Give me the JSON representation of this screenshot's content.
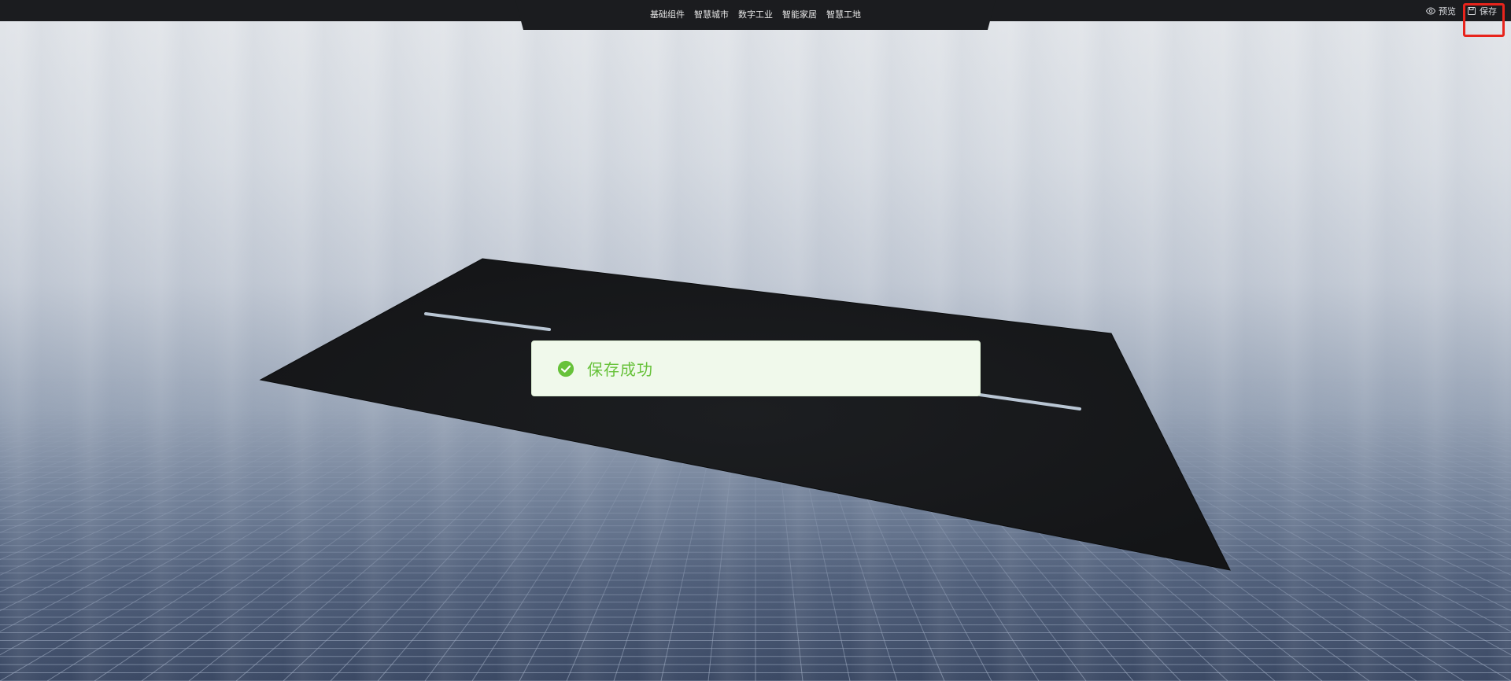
{
  "nav": {
    "items": [
      {
        "label": "基础组件"
      },
      {
        "label": "智慧城市"
      },
      {
        "label": "数字工业"
      },
      {
        "label": "智能家居"
      },
      {
        "label": "智慧工地"
      }
    ]
  },
  "actions": {
    "preview_label": "预览",
    "preview_icon": "eye-icon",
    "save_label": "保存",
    "save_icon": "save-icon"
  },
  "toast": {
    "type": "success",
    "message": "保存成功",
    "icon": "check-circle-icon"
  },
  "colors": {
    "topbar": "#1b1c1f",
    "success": "#67c23a",
    "toast_bg": "#f0f9eb",
    "highlight": "#e8241c"
  }
}
